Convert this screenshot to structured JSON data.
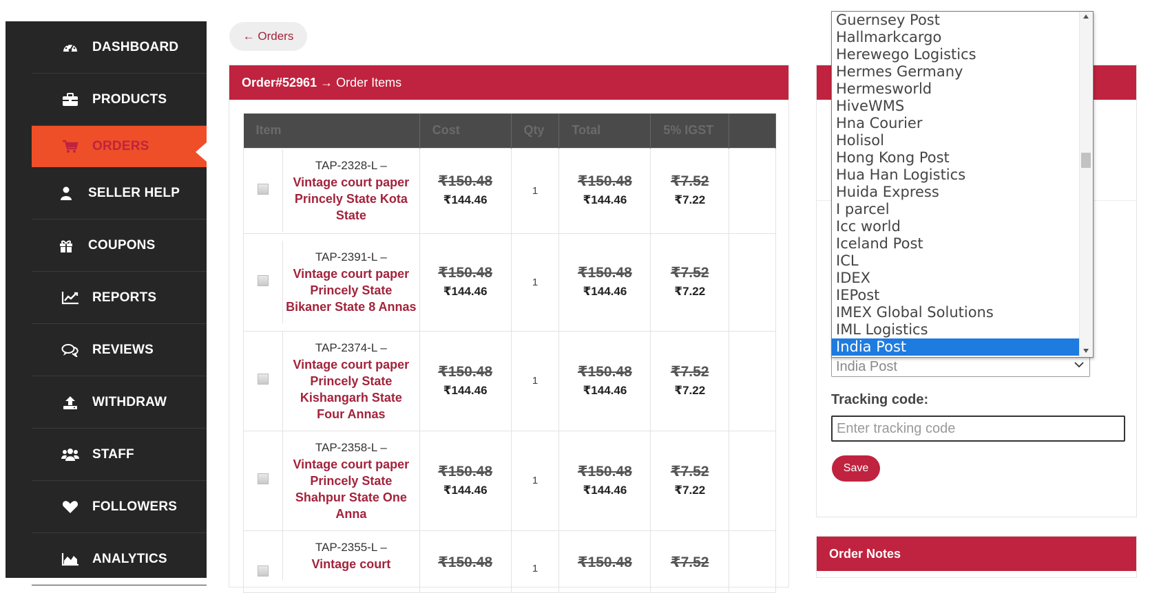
{
  "sidebar": {
    "items": [
      {
        "label": "DASHBOARD",
        "icon": "dashboard-icon"
      },
      {
        "label": "PRODUCTS",
        "icon": "briefcase-icon"
      },
      {
        "label": "ORDERS",
        "icon": "cart-icon",
        "active": true
      },
      {
        "label": "SELLER HELP",
        "icon": "user-icon"
      },
      {
        "label": "COUPONS",
        "icon": "gift-icon"
      },
      {
        "label": "REPORTS",
        "icon": "line-chart-icon"
      },
      {
        "label": "REVIEWS",
        "icon": "comments-icon"
      },
      {
        "label": "WITHDRAW",
        "icon": "upload-icon"
      },
      {
        "label": "STAFF",
        "icon": "users-icon"
      },
      {
        "label": "FOLLOWERS",
        "icon": "heart-icon"
      },
      {
        "label": "ANALYTICS",
        "icon": "area-chart-icon"
      }
    ]
  },
  "back_link": "← Orders",
  "order": {
    "number": "Order#52961",
    "breadcrumb_suffix": "→ Order Items",
    "columns": [
      "Item",
      "Cost",
      "Qty",
      "Total",
      "5% IGST"
    ],
    "rows": [
      {
        "sku": "TAP-2328-L –",
        "name": "Vintage court paper Princely State Kota State",
        "cost_old": "₹150.48",
        "cost_new": "₹144.46",
        "qty": "1",
        "total_old": "₹150.48",
        "total_new": "₹144.46",
        "tax_old": "₹7.52",
        "tax_new": "₹7.22"
      },
      {
        "sku": "TAP-2391-L –",
        "name": "Vintage court paper Princely State Bikaner State 8 Annas",
        "cost_old": "₹150.48",
        "cost_new": "₹144.46",
        "qty": "1",
        "total_old": "₹150.48",
        "total_new": "₹144.46",
        "tax_old": "₹7.52",
        "tax_new": "₹7.22"
      },
      {
        "sku": "TAP-2374-L –",
        "name": "Vintage court paper Princely State Kishangarh State Four Annas",
        "cost_old": "₹150.48",
        "cost_new": "₹144.46",
        "qty": "1",
        "total_old": "₹150.48",
        "total_new": "₹144.46",
        "tax_old": "₹7.52",
        "tax_new": "₹7.22"
      },
      {
        "sku": "TAP-2358-L –",
        "name": "Vintage court paper Princely State Shahpur State One Anna",
        "cost_old": "₹150.48",
        "cost_new": "₹144.46",
        "qty": "1",
        "total_old": "₹150.48",
        "total_new": "₹144.46",
        "tax_old": "₹7.52",
        "tax_new": "₹7.22"
      },
      {
        "sku": "TAP-2355-L –",
        "name": "Vintage court",
        "cost_old": "₹150.48",
        "cost_new": "",
        "qty": "1",
        "total_old": "₹150.48",
        "total_new": "",
        "tax_old": "₹7.52",
        "tax_new": ""
      }
    ]
  },
  "shipping": {
    "provider_options": [
      "Guernsey Post",
      "Hallmarkcargo",
      "Herewego Logistics",
      "Hermes Germany",
      "Hermesworld",
      "HiveWMS",
      "Hna Courier",
      "Holisol",
      "Hong Kong Post",
      "Hua Han Logistics",
      "Huida Express",
      "I parcel",
      "Icc world",
      "Iceland Post",
      "ICL",
      "IDEX",
      "IEPost",
      "IMEX Global Solutions",
      "IML Logistics",
      "India Post"
    ],
    "selected_provider": "India Post",
    "tracking_label": "Tracking code:",
    "tracking_placeholder": "Enter tracking code",
    "save_label": "Save"
  },
  "notes": {
    "title": "Order Notes"
  },
  "colors": {
    "brand_red": "#c0233f",
    "active_orange": "#ee4f28",
    "sidebar_bg": "#262626",
    "selection_blue": "#1e7be0"
  }
}
